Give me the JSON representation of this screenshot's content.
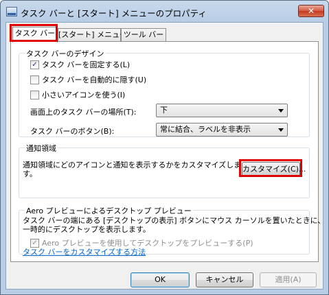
{
  "window": {
    "title": "タスク バーと [スタート] メニューのプロパティ",
    "close_glyph": "✕"
  },
  "tabs": [
    {
      "label": "タスク バー",
      "active": true
    },
    {
      "label": "[スタート] メニュー",
      "active": false
    },
    {
      "label": "ツール バー",
      "active": false
    }
  ],
  "design_group": {
    "label": "タスク バーのデザイン",
    "checkboxes": [
      {
        "label": "タスク バーを固定する(L)",
        "checked": true,
        "mark": "✓"
      },
      {
        "label": "タスク バーを自動的に隠す(U)",
        "checked": false,
        "mark": ""
      },
      {
        "label": "小さいアイコンを使う(I)",
        "checked": false,
        "mark": ""
      }
    ],
    "location_label": "画面上のタスク バーの場所(T):",
    "location_value": "下",
    "buttons_label": "タスク バーのボタン(B):",
    "buttons_value": "常に結合、ラベルを非表示"
  },
  "notification_group": {
    "label": "通知領域",
    "description_line1": "通知領域にどのアイコンと通知を表示するかをカスタマイズしま",
    "description_line2": "す。",
    "customize_button": "カスタマイズ(C)..."
  },
  "aero_group": {
    "label": "Aero プレビューによるデスクトップ プレビュー",
    "description_line1": "タスク バーの端にある [デスクトップの表示] ボタンにマウス カーソルを置いたときに、",
    "description_line2": "一時的にデスクトップを表示します。",
    "checkbox_label": "Aero プレビューを使用してデスクトップをプレビューする(P)",
    "checkbox_checked": true,
    "checkbox_mark": "✓"
  },
  "help_link": "タスク バーをカスタマイズする方法",
  "footer": {
    "ok": "OK",
    "cancel": "キャンセル",
    "apply": "適用(A)"
  }
}
